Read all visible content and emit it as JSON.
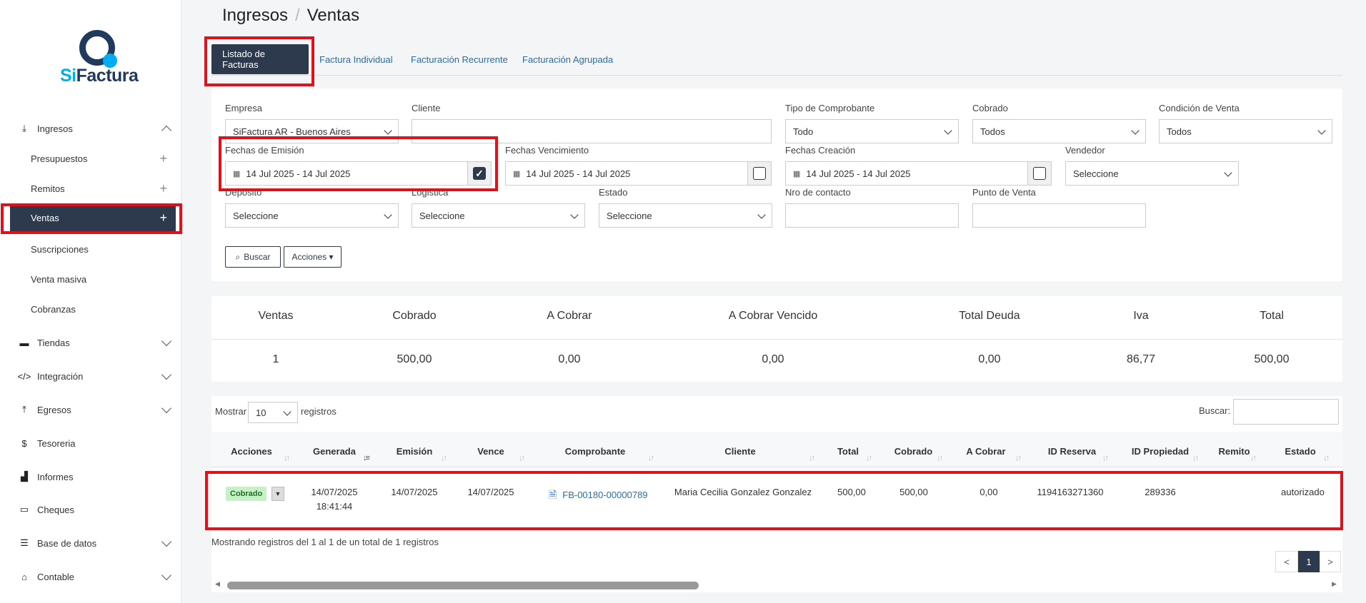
{
  "brand": {
    "logo_si": "Si",
    "logo_rest": "Factura"
  },
  "sidebar": {
    "ingresos": "Ingresos",
    "sub": [
      "Presupuestos",
      "Remitos",
      "Ventas",
      "Suscripciones",
      "Venta masiva",
      "Cobranzas"
    ],
    "items": [
      "Tiendas",
      "Integración",
      "Egresos",
      "Tesoreria",
      "Informes",
      "Cheques",
      "Base de datos",
      "Contable"
    ]
  },
  "breadcrumb": {
    "root": "Ingresos",
    "sep": "/",
    "current": "Ventas"
  },
  "tabs": [
    "Listado de Facturas",
    "Factura Individual",
    "Facturación Recurrente",
    "Facturación Agrupada"
  ],
  "filters": {
    "empresa_label": "Empresa",
    "empresa_value": "SiFactura AR - Buenos Aires",
    "cliente_label": "Cliente",
    "cliente_value": "",
    "tipo_label": "Tipo de Comprobante",
    "tipo_value": "Todo",
    "cobrado_label": "Cobrado",
    "cobrado_value": "Todos",
    "condicion_label": "Condición de Venta",
    "condicion_value": "Todos",
    "emision_label": "Fechas de Emisión",
    "emision_value": "14 Jul 2025 - 14 Jul 2025",
    "vencimiento_label": "Fechas Vencimiento",
    "vencimiento_value": "14 Jul 2025 - 14 Jul 2025",
    "creacion_label": "Fechas Creación",
    "creacion_value": "14 Jul 2025 - 14 Jul 2025",
    "vendedor_label": "Vendedor",
    "vendedor_value": "Seleccione",
    "deposito_label": "Deposito",
    "deposito_value": "Seleccione",
    "logistica_label": "Logistica",
    "logistica_value": "Seleccione",
    "estado_label": "Estado",
    "estado_value": "Seleccione",
    "contacto_label": "Nro de contacto",
    "contacto_value": "",
    "punto_label": "Punto de Venta",
    "punto_value": "",
    "buscar_btn": "Buscar",
    "acciones_btn": "Acciones ▾"
  },
  "summary": {
    "headers": [
      "Ventas",
      "Cobrado",
      "A Cobrar",
      "A Cobrar Vencido",
      "Total Deuda",
      "Iva",
      "Total"
    ],
    "values": [
      "1",
      "500,00",
      "0,00",
      "0,00",
      "0,00",
      "86,77",
      "500,00"
    ]
  },
  "table": {
    "show_label": "Mostrar",
    "show_value": "10",
    "records_label": "registros",
    "search_label": "Buscar:",
    "columns": [
      "Acciones",
      "Generada",
      "Emisión",
      "Vence",
      "Comprobante",
      "Cliente",
      "Total",
      "Cobrado",
      "A Cobrar",
      "ID Reserva",
      "ID Propiedad",
      "Remito",
      "Estado"
    ],
    "row": {
      "badge": "Cobrado",
      "generada_date": "14/07/2025",
      "generada_time": "18:41:44",
      "emision": "14/07/2025",
      "vence": "14/07/2025",
      "comprobante": "FB-00180-00000789",
      "cliente": "Maria Cecilia Gonzalez Gonzalez",
      "total": "500,00",
      "cobrado": "500,00",
      "a_cobrar": "0,00",
      "id_reserva": "1194163271360",
      "id_propiedad": "289336",
      "remito": "",
      "estado": "autorizado"
    },
    "footer": "Mostrando registros del 1 al 1 de un total de 1 registros",
    "pager": {
      "prev": "<",
      "page": "1",
      "next": ">"
    }
  }
}
